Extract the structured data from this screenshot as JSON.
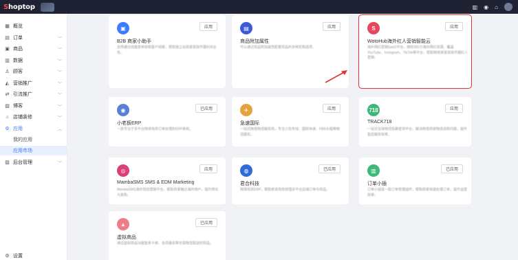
{
  "brand": {
    "first_letter": "S",
    "rest": "hoptop"
  },
  "nav": [
    {
      "label": "概览",
      "icon": "chart-icon"
    },
    {
      "label": "订单",
      "icon": "order-icon",
      "chevron": true
    },
    {
      "label": "商品",
      "icon": "box-icon",
      "chevron": true
    },
    {
      "label": "数据",
      "icon": "bar-chart-icon",
      "chevron": true
    },
    {
      "label": "顾客",
      "icon": "user-icon",
      "chevron": true
    },
    {
      "label": "营销推广",
      "icon": "megaphone-icon",
      "chevron": true
    },
    {
      "label": "引流推广",
      "icon": "traffic-icon",
      "chevron": true
    },
    {
      "label": "博客",
      "icon": "blog-icon",
      "chevron": true
    },
    {
      "label": "店铺装修",
      "icon": "store-icon",
      "chevron": true
    },
    {
      "label": "应用",
      "icon": "app-icon",
      "chevron": true,
      "open": true
    },
    {
      "label": "我的应用",
      "sub": true
    },
    {
      "label": "应用市场",
      "sub": true,
      "active": true
    },
    {
      "label": "后台管理",
      "icon": "admin-icon",
      "chevron": true
    },
    {
      "label": "设置",
      "icon": "settings-icon"
    }
  ],
  "cards": [
    {
      "title": "B2B 商家小助手",
      "button": "应用",
      "icon": "b2b-icon",
      "color": "#3d7bff",
      "symbol": "▣",
      "desc": "支持通过询盘表单获取客户线索，帮助独立站商家高效开展B2B业务。"
    },
    {
      "title": "商品附加属性",
      "button": "应用",
      "icon": "attribute-icon",
      "color": "#3d5bd9",
      "symbol": "▤",
      "desc": "可以通过商品附加属性配置商品的多种定制选项。"
    },
    {
      "title": "WotoHub海外红人营销智能云",
      "button": "应用",
      "icon": "wotohub-icon",
      "color": "#e8455f",
      "symbol": "S",
      "desc": "海外网红营销SaaS平台，拥有300万海外网红资源，覆盖YouTube、Instagram、TikTok等平台，帮助跨境卖家高效开展红人营销。",
      "highlight": true
    },
    {
      "title": "小老板ERP",
      "button": "已应用",
      "icon": "erp-icon",
      "color": "#5a7fd6",
      "symbol": "◉",
      "desc": "一款专注于多平台跨境电商订单处理的ERP系统。"
    },
    {
      "title": "急速国际",
      "button": "应用",
      "icon": "express-icon",
      "color": "#e6a23c",
      "symbol": "✈",
      "desc": "一站式跨境物流服务商，专注小包专线、国际快递、FBA头程等物流服务。"
    },
    {
      "title": "TRACK718",
      "button": "应用",
      "icon": "track718-icon",
      "color": "#3cb878",
      "symbol": "718",
      "desc": "一站式全球物流包裹查询平台，解决跨境商家物流追踪问题，提升售后服务效率。"
    },
    {
      "title": "MambaSMS SMS & EDM Marketing",
      "button": "应用",
      "icon": "mambasms-icon",
      "color": "#d9407a",
      "symbol": "◎",
      "desc": "MambaSMS海外短信营销平台，帮助商家触达海外用户，提升转化与复购。"
    },
    {
      "title": "君合科技",
      "button": "已应用",
      "icon": "junhe-icon",
      "color": "#2f6bd9",
      "symbol": "◍",
      "desc": "跨境电商ERP，帮助卖家高效管理多平台店铺订单与商品。"
    },
    {
      "title": "订单小插",
      "button": "已应用",
      "icon": "order-plugin-icon",
      "color": "#3cb878",
      "symbol": "▥",
      "desc": "订单小插是一款订单管理插件，帮助商家快速处理订单，提升运营效率。"
    },
    {
      "title": "虚拟商品",
      "button": "已应用",
      "icon": "virtual-goods-icon",
      "color": "#f07c8a",
      "symbol": "▲",
      "desc": "通过虚拟商品功能售卖卡券、会员服务等无需物流配送的商品。"
    }
  ]
}
